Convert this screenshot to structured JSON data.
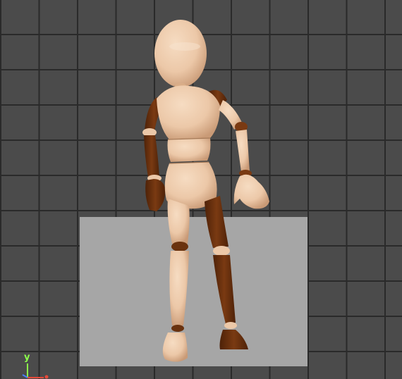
{
  "viewport": {
    "background": "#4b4b4b",
    "grid_color": "#2a2a2a",
    "box_color": "#a5a5a5",
    "skin_color": "#ecc8a8",
    "skin_shadow": "#d9ad88",
    "dark_limb_color": "#6a320e"
  },
  "gizmo": {
    "y_label": "y",
    "y_axis_color": "#8cff4a",
    "x_axis_color": "#e84a3a",
    "z_axis_color": "#4a7dff"
  }
}
